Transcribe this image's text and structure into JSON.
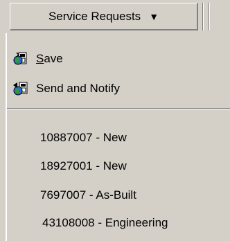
{
  "toolbar": {
    "menu_label": "Service Requests",
    "menu_arrow": "▼"
  },
  "menu": {
    "save_accel": "S",
    "save_rest": "ave",
    "send_label": "Send and Notify"
  },
  "requests": [
    "10887007 - New",
    "18927001 - New",
    "7697007 - As-Built",
    "43108008 - Engineering"
  ]
}
